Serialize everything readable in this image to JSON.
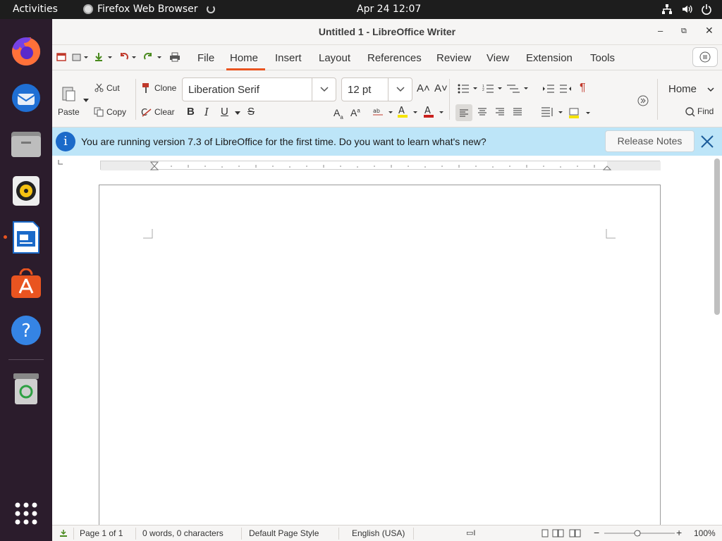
{
  "topbar": {
    "activities": "Activities",
    "app_name": "Firefox Web Browser",
    "clock": "Apr 24  12:07"
  },
  "dock": {
    "items": [
      "firefox",
      "thunderbird",
      "files",
      "rhythmbox",
      "libreoffice-writer",
      "software-center",
      "help",
      "trash",
      "show-apps"
    ],
    "active_indicator": "libreoffice-writer"
  },
  "window": {
    "title": "Untitled 1 - LibreOffice Writer"
  },
  "menubar": {
    "items": [
      "File",
      "Home",
      "Insert",
      "Layout",
      "References",
      "Review",
      "View",
      "Extension",
      "Tools"
    ],
    "active": "Home"
  },
  "toolbar": {
    "paste": "Paste",
    "cut": "Cut",
    "copy": "Copy",
    "clone": "Clone",
    "clear": "Clear",
    "font_name": "Liberation Serif",
    "font_size": "12 pt",
    "home_dropdown": "Home",
    "find": "Find"
  },
  "infobar": {
    "message": "You are running version 7.3 of LibreOffice for the first time. Do you want to learn what's new?",
    "button": "Release Notes"
  },
  "statusbar": {
    "page": "Page 1 of 1",
    "words": "0 words, 0 characters",
    "page_style": "Default Page Style",
    "language": "English (USA)",
    "zoom": "100%"
  },
  "colors": {
    "accent": "#e95420",
    "infobar_bg": "#bde5f8",
    "info_icon": "#1b6ac9"
  }
}
